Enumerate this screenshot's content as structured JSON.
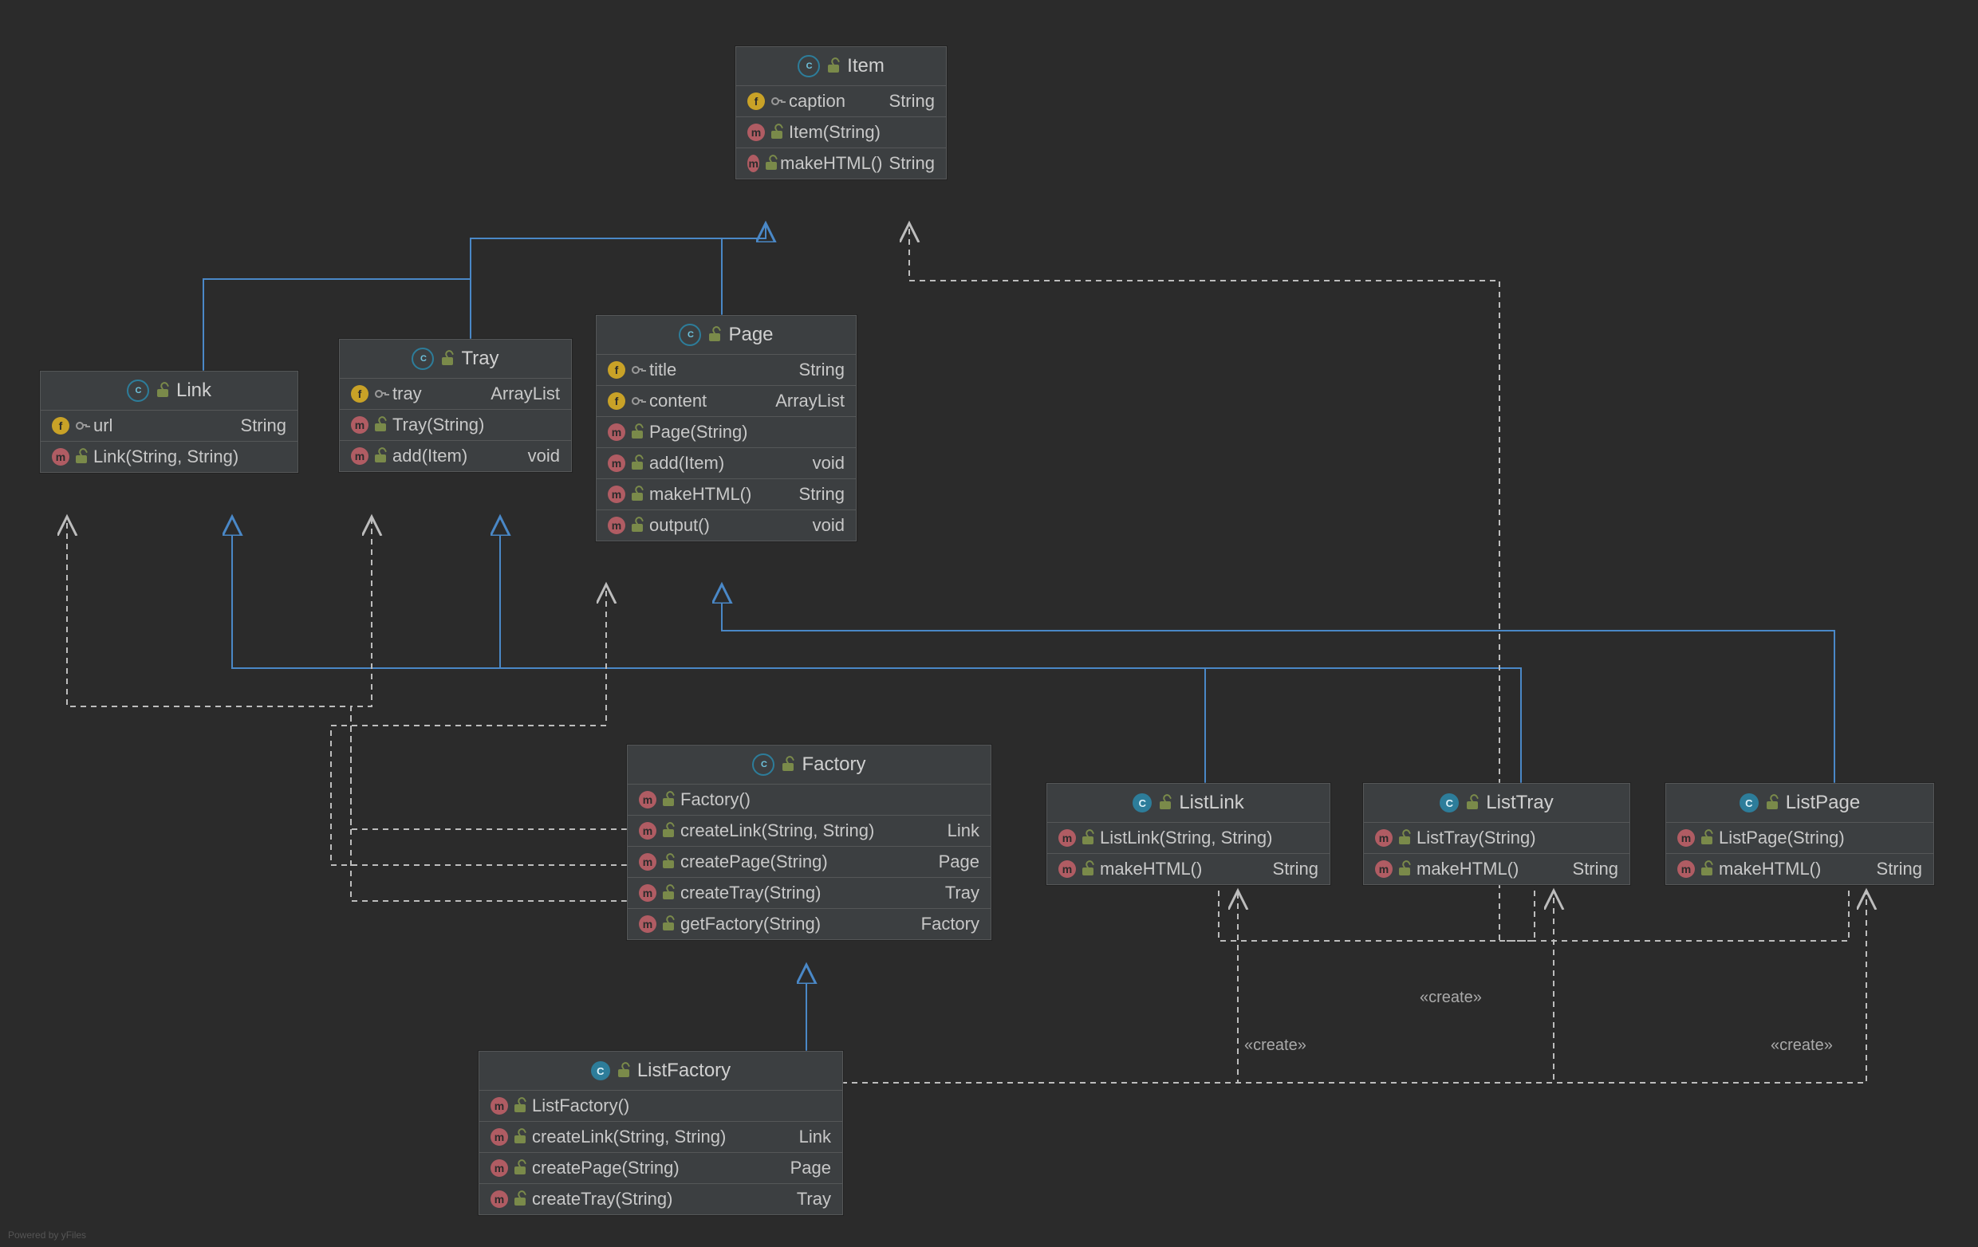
{
  "watermark": "Powered by yFiles",
  "labels": {
    "create": "«create»"
  },
  "colors": {
    "background": "#2b2b2b",
    "box": "#3c3f41",
    "border": "#555758",
    "text": "#c8c8c8",
    "inheritance": "#4a88c7",
    "dependency": "#bdbdbd",
    "badge_field": "#c9a227",
    "badge_method": "#b05c63",
    "class_icon": "#2d7d9a",
    "lock": "#7a8a4a"
  },
  "classes": {
    "Item": {
      "name": "Item",
      "kind": "abstract",
      "members": [
        {
          "kind": "field",
          "name": "caption",
          "type": "String"
        },
        {
          "kind": "method",
          "name": "Item(String)"
        },
        {
          "kind": "method",
          "name": "makeHTML()",
          "type": "String"
        }
      ]
    },
    "Link": {
      "name": "Link",
      "kind": "abstract",
      "extends": "Item",
      "members": [
        {
          "kind": "field",
          "name": "url",
          "type": "String"
        },
        {
          "kind": "method",
          "name": "Link(String, String)"
        }
      ]
    },
    "Tray": {
      "name": "Tray",
      "kind": "abstract",
      "extends": "Item",
      "members": [
        {
          "kind": "field",
          "name": "tray",
          "type": "ArrayList"
        },
        {
          "kind": "method",
          "name": "Tray(String)"
        },
        {
          "kind": "method",
          "name": "add(Item)",
          "type": "void"
        }
      ]
    },
    "Page": {
      "name": "Page",
      "kind": "abstract",
      "members": [
        {
          "kind": "field",
          "name": "title",
          "type": "String"
        },
        {
          "kind": "field",
          "name": "content",
          "type": "ArrayList"
        },
        {
          "kind": "method",
          "name": "Page(String)"
        },
        {
          "kind": "method",
          "name": "add(Item)",
          "type": "void"
        },
        {
          "kind": "method",
          "name": "makeHTML()",
          "type": "String"
        },
        {
          "kind": "method",
          "name": "output()",
          "type": "void"
        }
      ]
    },
    "Factory": {
      "name": "Factory",
      "kind": "abstract",
      "members": [
        {
          "kind": "method",
          "name": "Factory()"
        },
        {
          "kind": "method",
          "name": "createLink(String, String)",
          "type": "Link"
        },
        {
          "kind": "method",
          "name": "createPage(String)",
          "type": "Page"
        },
        {
          "kind": "method",
          "name": "createTray(String)",
          "type": "Tray"
        },
        {
          "kind": "method",
          "name": "getFactory(String)",
          "type": "Factory"
        }
      ]
    },
    "ListLink": {
      "name": "ListLink",
      "kind": "class",
      "extends": "Link",
      "members": [
        {
          "kind": "method",
          "name": "ListLink(String, String)"
        },
        {
          "kind": "method",
          "name": "makeHTML()",
          "type": "String"
        }
      ]
    },
    "ListTray": {
      "name": "ListTray",
      "kind": "class",
      "extends": "Tray",
      "members": [
        {
          "kind": "method",
          "name": "ListTray(String)"
        },
        {
          "kind": "method",
          "name": "makeHTML()",
          "type": "String"
        }
      ]
    },
    "ListPage": {
      "name": "ListPage",
      "kind": "class",
      "extends": "Page",
      "members": [
        {
          "kind": "method",
          "name": "ListPage(String)"
        },
        {
          "kind": "method",
          "name": "makeHTML()",
          "type": "String"
        }
      ]
    },
    "ListFactory": {
      "name": "ListFactory",
      "kind": "class",
      "extends": "Factory",
      "members": [
        {
          "kind": "method",
          "name": "ListFactory()"
        },
        {
          "kind": "method",
          "name": "createLink(String, String)",
          "type": "Link"
        },
        {
          "kind": "method",
          "name": "createPage(String)",
          "type": "Page"
        },
        {
          "kind": "method",
          "name": "createTray(String)",
          "type": "Tray"
        }
      ]
    }
  },
  "relationships": {
    "inheritance": [
      {
        "from": "Link",
        "to": "Item"
      },
      {
        "from": "Tray",
        "to": "Item"
      },
      {
        "from": "Page",
        "to": "Item"
      },
      {
        "from": "ListLink",
        "to": "Link"
      },
      {
        "from": "ListTray",
        "to": "Tray"
      },
      {
        "from": "ListPage",
        "to": "Page"
      },
      {
        "from": "ListFactory",
        "to": "Factory"
      }
    ],
    "dependency": [
      {
        "from": "Factory",
        "to": "Link"
      },
      {
        "from": "Factory",
        "to": "Tray"
      },
      {
        "from": "Factory",
        "to": "Page"
      },
      {
        "from": "ListLink",
        "to": "Item"
      },
      {
        "from": "ListTray",
        "to": "Item"
      },
      {
        "from": "ListPage",
        "to": "Item"
      }
    ],
    "create": [
      {
        "from": "ListFactory",
        "to": "ListLink"
      },
      {
        "from": "ListFactory",
        "to": "ListTray"
      },
      {
        "from": "ListFactory",
        "to": "ListPage"
      }
    ]
  }
}
